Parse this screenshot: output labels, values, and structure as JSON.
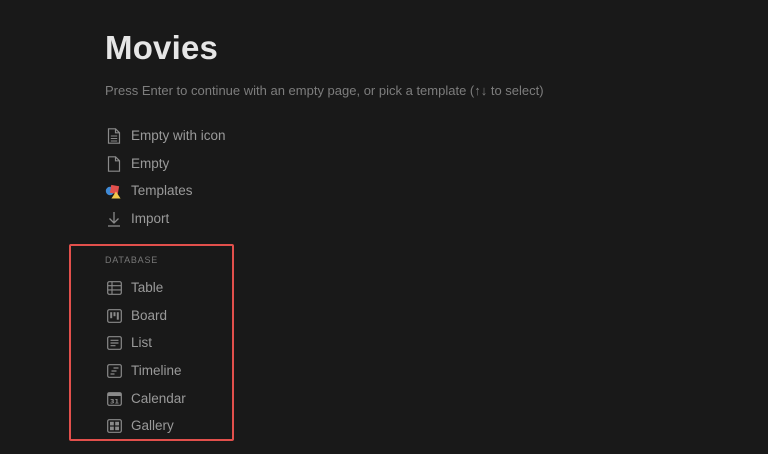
{
  "page": {
    "title": "Movies",
    "hint": "Press Enter to continue with an empty page, or pick a template (↑↓ to select)"
  },
  "options": [
    {
      "label": "Empty with icon",
      "icon": "page-with-lines-icon"
    },
    {
      "label": "Empty",
      "icon": "page-icon"
    },
    {
      "label": "Templates",
      "icon": "shapes-icon"
    },
    {
      "label": "Import",
      "icon": "download-arrow-icon"
    }
  ],
  "database": {
    "section_label": "DATABASE",
    "items": [
      {
        "label": "Table",
        "icon": "table-icon"
      },
      {
        "label": "Board",
        "icon": "board-icon"
      },
      {
        "label": "List",
        "icon": "list-icon"
      },
      {
        "label": "Timeline",
        "icon": "timeline-icon"
      },
      {
        "label": "Calendar",
        "icon": "calendar-icon"
      },
      {
        "label": "Gallery",
        "icon": "gallery-icon"
      }
    ]
  },
  "colors": {
    "background": "#191919",
    "title": "#e6e6e6",
    "text": "#9a9a9a",
    "highlight": "#e2504c",
    "template_red": "#e2504c",
    "template_blue": "#3f8ad6",
    "template_yellow": "#f2c94c"
  }
}
